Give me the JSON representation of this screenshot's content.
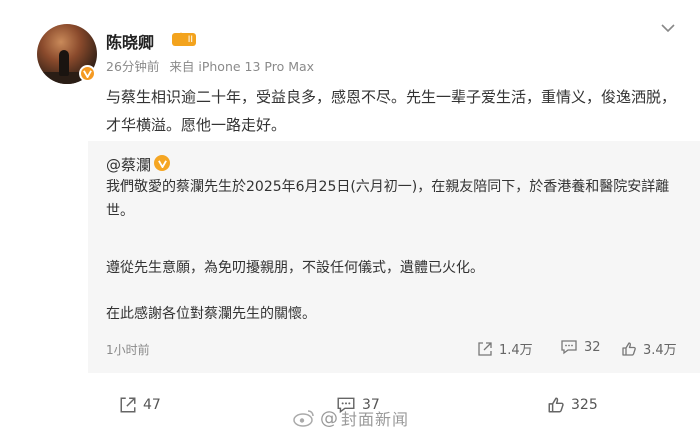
{
  "post": {
    "author": "陈晓卿",
    "level_badge": "II",
    "time": "26分钟前",
    "source": "来自 iPhone 13 Pro Max",
    "text": "与蔡生相识逾二十年，受益良多，感恩不尽。先生一辈子爱生活，重情义，俊逸洒脱，才华横溢。愿他一路走好。"
  },
  "repost": {
    "mention": "@蔡瀾",
    "paragraphs": [
      "我們敬愛的蔡瀾先生於2025年6月25日(六月初一)，在親友陪同下，於香港養和醫院安詳離世。",
      "遵從先生意願，為免叨擾親朋，不設任何儀式，遺體已火化。",
      "在此感謝各位對蔡瀾先生的關懷。"
    ],
    "time": "1小时前",
    "stats": {
      "reposts": "1.4万",
      "comments": "32",
      "likes": "3.4万"
    }
  },
  "footer": {
    "reposts": "47",
    "comments": "37",
    "likes": "325"
  },
  "watermark": {
    "text": "封面新闻"
  },
  "icons": {
    "header": "chevron-down-icon",
    "verified": "verified-v-icon",
    "share": "share-icon",
    "comment": "comment-icon",
    "like": "like-icon",
    "watermark_logo": "weibo-logo-icon"
  },
  "colors": {
    "accent": "#f5a623",
    "repost_bg": "#f6f6f6",
    "meta": "#8a8a8a"
  }
}
